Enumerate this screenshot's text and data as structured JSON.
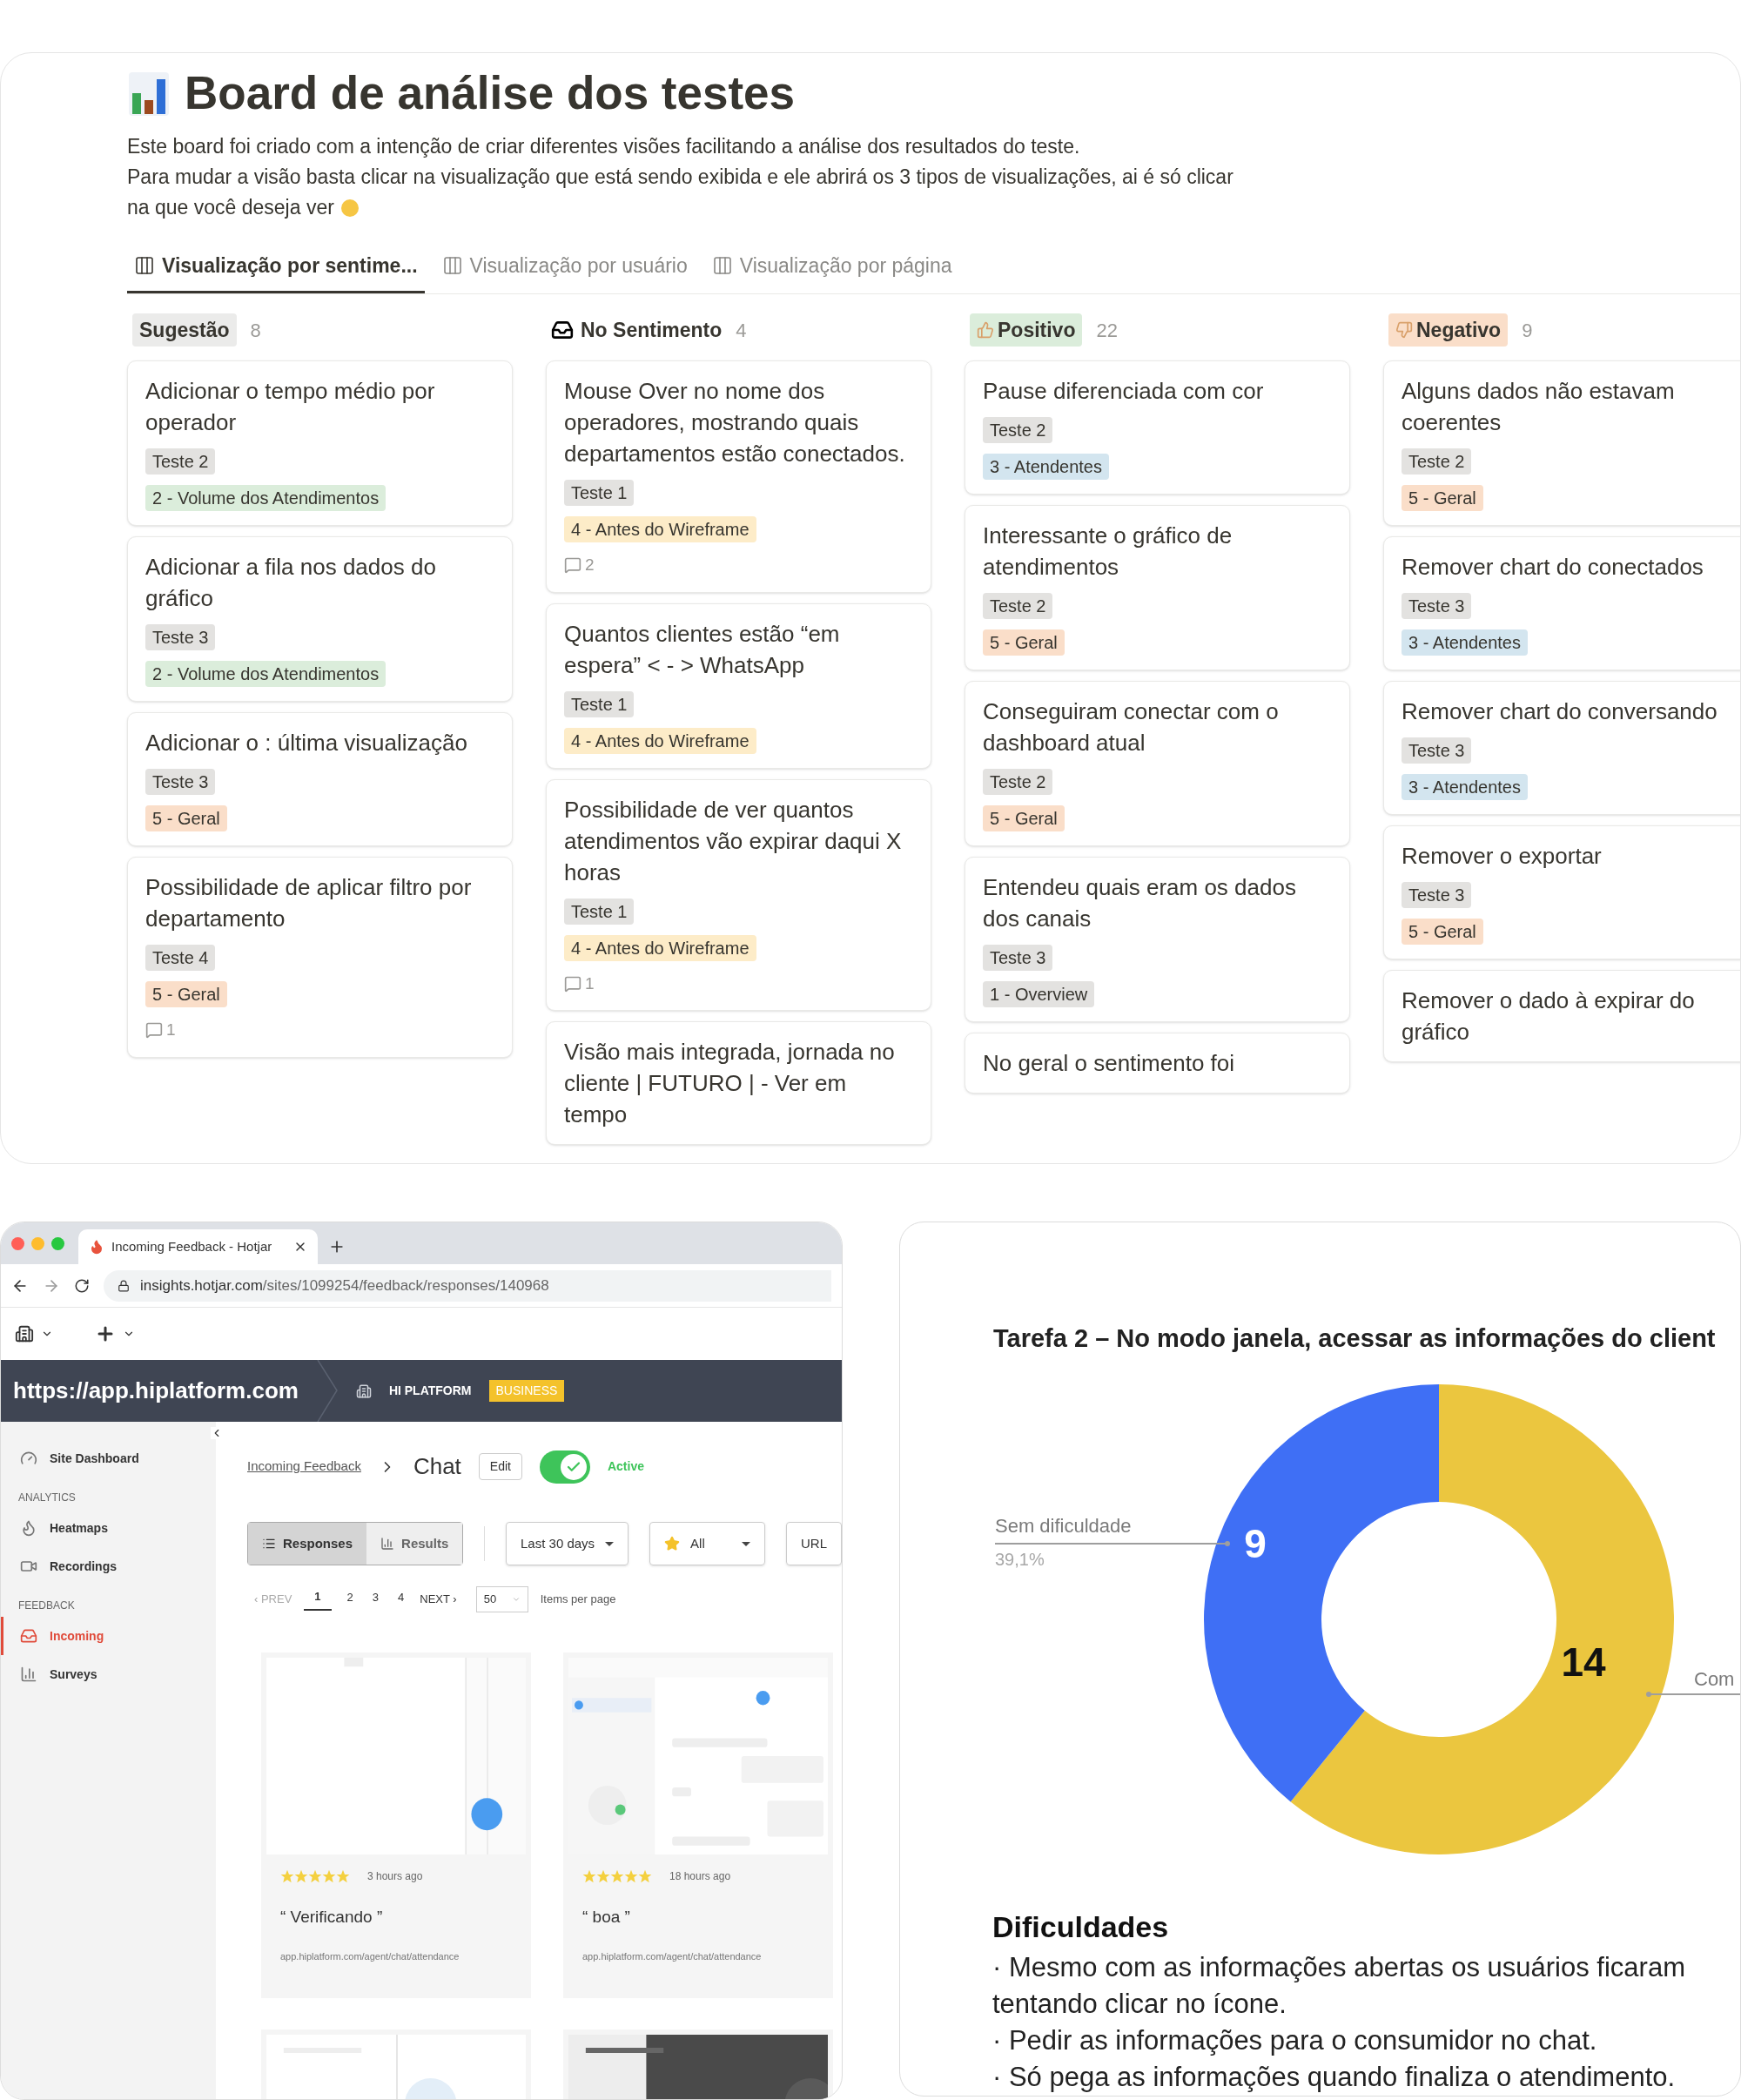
{
  "board": {
    "title": "Board de análise dos testes",
    "description": [
      "Este board foi criado com a intenção de criar diferentes visões facilitando a análise dos resultados do teste.",
      "Para mudar a visão basta clicar na visualização que está sendo exibida e ele abrirá os 3 tipos de visualizações, ai é só clicar na que você deseja ver"
    ],
    "tabs": [
      {
        "label": "Visualização por sentime...",
        "selected": true
      },
      {
        "label": "Visualização por usuário",
        "selected": false
      },
      {
        "label": "Visualização por página",
        "selected": false
      }
    ],
    "columns": [
      {
        "name": "Sugestão",
        "count": "8",
        "kind": "badge",
        "color": "#ebebea",
        "cards": [
          {
            "title": "Adicionar o tempo médio por operador",
            "tags": [
              {
                "text": "Teste 2",
                "color": "#e3e2e0"
              },
              {
                "text": "2 - Volume dos Atendimentos",
                "color": "#dbeddb"
              }
            ]
          },
          {
            "title": "Adicionar a fila nos dados do gráfico",
            "tags": [
              {
                "text": "Teste 3",
                "color": "#e3e2e0"
              },
              {
                "text": "2 - Volume dos Atendimentos",
                "color": "#dbeddb"
              }
            ]
          },
          {
            "title": "Adicionar o : última visualização",
            "tags": [
              {
                "text": "Teste 3",
                "color": "#e3e2e0"
              },
              {
                "text": "5 - Geral",
                "color": "#fadec9"
              }
            ]
          },
          {
            "title": "Possibilidade de aplicar filtro por departamento",
            "tags": [
              {
                "text": "Teste 4",
                "color": "#e3e2e0"
              },
              {
                "text": "5 - Geral",
                "color": "#fadec9"
              }
            ],
            "comments": "1"
          }
        ]
      },
      {
        "name": "No Sentimento",
        "count": "4",
        "kind": "inbox",
        "cards": [
          {
            "title": "Mouse Over no nome dos operadores, mostrando quais departamentos estão conectados.",
            "tags": [
              {
                "text": "Teste 1",
                "color": "#e3e2e0"
              },
              {
                "text": "4 - Antes do Wireframe",
                "color": "#fdecc8"
              }
            ],
            "comments": "2"
          },
          {
            "title": "Quantos clientes estão “em espera” < - > WhatsApp",
            "tags": [
              {
                "text": "Teste 1",
                "color": "#e3e2e0"
              },
              {
                "text": "4 - Antes do Wireframe",
                "color": "#fdecc8"
              }
            ]
          },
          {
            "title": "Possibilidade de ver quantos atendimentos vão expirar daqui X horas",
            "tags": [
              {
                "text": "Teste 1",
                "color": "#e3e2e0"
              },
              {
                "text": "4 - Antes do Wireframe",
                "color": "#fdecc8"
              }
            ],
            "comments": "1"
          },
          {
            "title": "Visão mais integrada, jornada no cliente | FUTURO | - Ver em tempo"
          }
        ]
      },
      {
        "name": "Positivo",
        "count": "22",
        "kind": "thumbs-up",
        "color": "#dbeddb",
        "cards": [
          {
            "title": "Pause diferenciada com cor",
            "tags": [
              {
                "text": "Teste 2",
                "color": "#e3e2e0"
              },
              {
                "text": "3 - Atendentes",
                "color": "#d3e5ef"
              }
            ]
          },
          {
            "title": "Interessante o gráfico de atendimentos",
            "tags": [
              {
                "text": "Teste 2",
                "color": "#e3e2e0"
              },
              {
                "text": "5 - Geral",
                "color": "#fadec9"
              }
            ]
          },
          {
            "title": "Conseguiram conectar com o dashboard atual",
            "tags": [
              {
                "text": "Teste 2",
                "color": "#e3e2e0"
              },
              {
                "text": "5 - Geral",
                "color": "#fadec9"
              }
            ]
          },
          {
            "title": "Entendeu quais eram os dados dos canais",
            "tags": [
              {
                "text": "Teste 3",
                "color": "#e3e2e0"
              },
              {
                "text": "1 - Overview",
                "color": "#e3e2e0"
              }
            ]
          },
          {
            "title": "No geral o sentimento foi"
          }
        ]
      },
      {
        "name": "Negativo",
        "count": "9",
        "kind": "thumbs-down",
        "color": "#fadec9",
        "cards": [
          {
            "title": "Alguns dados não estavam coerentes",
            "tags": [
              {
                "text": "Teste 2",
                "color": "#e3e2e0"
              },
              {
                "text": "5 - Geral",
                "color": "#fadec9"
              }
            ]
          },
          {
            "title": "Remover chart do conectados",
            "tags": [
              {
                "text": "Teste 3",
                "color": "#e3e2e0"
              },
              {
                "text": "3 - Atendentes",
                "color": "#d3e5ef"
              }
            ]
          },
          {
            "title": "Remover chart do conversando",
            "tags": [
              {
                "text": "Teste 3",
                "color": "#e3e2e0"
              },
              {
                "text": "3 - Atendentes",
                "color": "#d3e5ef"
              }
            ]
          },
          {
            "title": "Remover o exportar",
            "tags": [
              {
                "text": "Teste 3",
                "color": "#e3e2e0"
              },
              {
                "text": "5 - Geral",
                "color": "#fadec9"
              }
            ]
          },
          {
            "title": "Remover o dado à expirar do gráfico"
          }
        ]
      }
    ]
  },
  "browser": {
    "tab_title": "Incoming Feedback - Hotjar",
    "url_host": "insights.hotjar.com",
    "url_path": "/sites/1099254/feedback/responses/140968",
    "site_url": "https://app.hiplatform.com",
    "org": "HI PLATFORM",
    "plan": "BUSINESS",
    "sidebar": [
      {
        "kind": "item",
        "label": "Site Dashboard",
        "selected": false
      },
      {
        "kind": "section",
        "label": "ANALYTICS"
      },
      {
        "kind": "item",
        "label": "Heatmaps",
        "selected": false
      },
      {
        "kind": "item",
        "label": "Recordings",
        "selected": false
      },
      {
        "kind": "section",
        "label": "FEEDBACK"
      },
      {
        "kind": "item",
        "label": "Incoming",
        "selected": true
      },
      {
        "kind": "item",
        "label": "Surveys",
        "selected": false
      }
    ],
    "breadcrumb": "Incoming Feedback",
    "page_title": "Chat",
    "edit": "Edit",
    "active": {
      "on": true,
      "label": "Active"
    },
    "views": [
      {
        "label": "Responses",
        "selected": true
      },
      {
        "label": "Results",
        "selected": false
      }
    ],
    "filters": [
      {
        "label": "Last 30 days",
        "kind": "date"
      },
      {
        "label": "All",
        "kind": "rating"
      },
      {
        "label": "URL",
        "kind": "url"
      }
    ],
    "pagination": {
      "prev": "‹ PREV",
      "pages": [
        {
          "label": "1",
          "selected": true
        },
        {
          "label": "2",
          "selected": false
        },
        {
          "label": "3",
          "selected": false
        },
        {
          "label": "4",
          "selected": false
        }
      ],
      "next": "NEXT ›",
      "per_page": "50",
      "per_page_label": "Items per page"
    },
    "responses": [
      {
        "stars": 5,
        "time": "3 hours ago",
        "text": "“ Verificando ”",
        "url": "app.hiplatform.com/agent/chat/attendance"
      },
      {
        "stars": 5,
        "time": "18 hours ago",
        "text": "“ boa ”",
        "url": "app.hiplatform.com/agent/chat/attendance"
      }
    ]
  },
  "chart_card": {
    "chart_data": {
      "type": "donut",
      "title": "Tarefa 2 – No modo janela, acessar as informações do client",
      "categories": [
        "Sem dificuldade",
        "Com"
      ],
      "values": [
        9,
        14
      ],
      "data_labels": true,
      "annotations": [
        "39,1%"
      ]
    },
    "heading": "Dificuldades",
    "items": [
      "· Mesmo com as informações abertas os usuários ficaram tentando clicar no ícone.",
      "· Pedir as informações para o consumidor no chat.",
      "· Só pega as informações quando finaliza o atendimento."
    ]
  }
}
